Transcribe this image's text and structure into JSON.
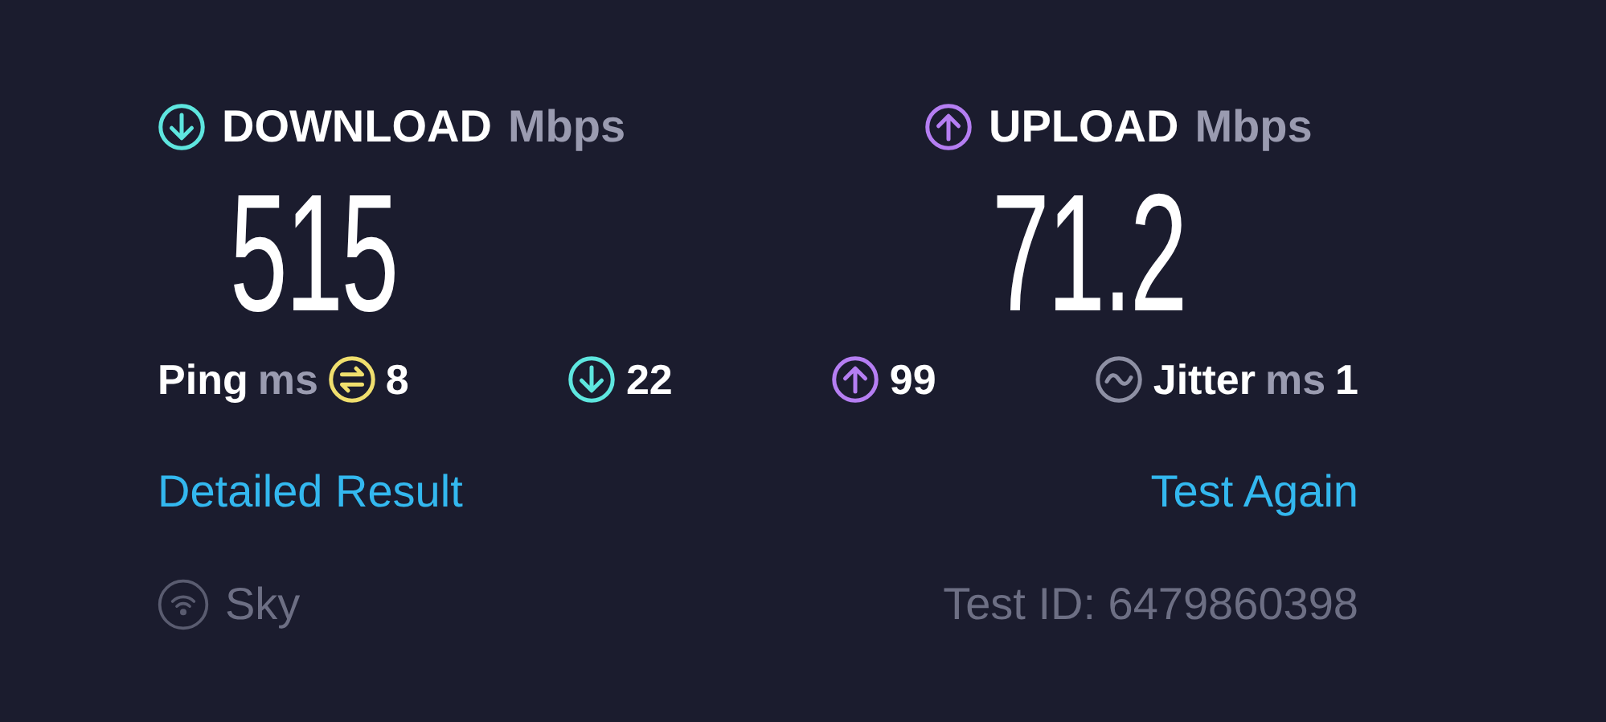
{
  "results": [
    {
      "kind": "download",
      "label": "DOWNLOAD",
      "unit": "Mbps",
      "value": "515"
    },
    {
      "kind": "upload",
      "label": "UPLOAD",
      "unit": "Mbps",
      "value": "71.2"
    }
  ],
  "stats": [
    {
      "kind": "ping",
      "label": "Ping",
      "unit": "ms",
      "value": "8"
    },
    {
      "kind": "download",
      "value": "22"
    },
    {
      "kind": "upload",
      "value": "99"
    },
    {
      "kind": "jitter",
      "label": "Jitter",
      "unit": "ms",
      "value": "1"
    }
  ],
  "links": [
    "Detailed Result",
    "Test Again"
  ],
  "provider": "Sky",
  "test_id": "Test ID: 6479860398"
}
